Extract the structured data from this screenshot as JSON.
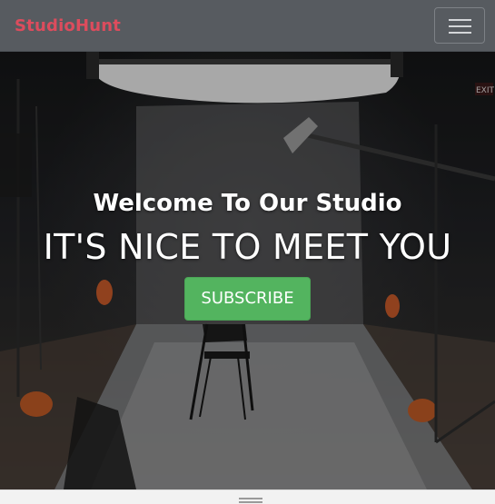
{
  "navbar": {
    "brand": "StudioHunt",
    "brand_color": "#dc4c5d",
    "menu_icon": "hamburger-menu-icon",
    "background": "#575b60"
  },
  "hero": {
    "subtitle": "Welcome To Our Studio",
    "title": "IT'S NICE TO MEET YOU",
    "button_label": "SUBSCRIBE",
    "button_color": "#53b45f",
    "exit_sign": "EXIT",
    "background_description_icon": "photo-studio-backdrop"
  },
  "splitter": {
    "icon": "drag-handle-icon"
  }
}
